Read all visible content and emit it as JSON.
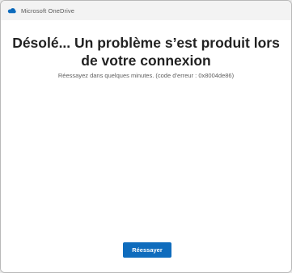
{
  "window": {
    "title": "Microsoft OneDrive",
    "icon": "onedrive-cloud-icon"
  },
  "dialog": {
    "headline": "Désolé... Un problème s’est produit lors de votre connexion",
    "message": "Réessayez dans quelques minutes. (code d’erreur : 0x8004de86)",
    "retry_label": "Réessayer"
  },
  "colors": {
    "accent": "#0f6cbd",
    "titlebar_bg": "#f3f3f3",
    "content_bg": "#ffffff",
    "headline_text": "#222222",
    "subtext": "#5d5d5d"
  }
}
